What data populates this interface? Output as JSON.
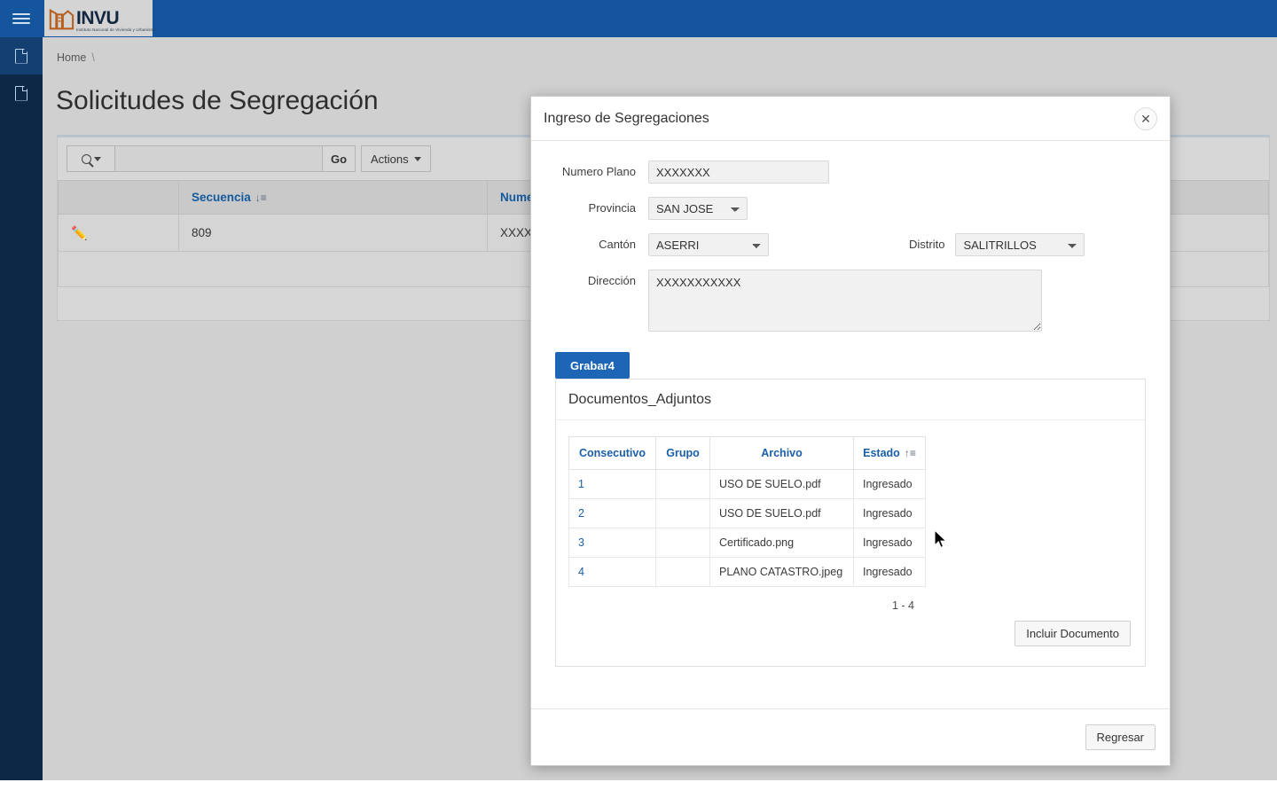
{
  "app": {
    "brand_word": "INVU",
    "brand_tagline": "Instituto Nacional de Vivienda y Urbanismo",
    "menu_icon": "hamburger-icon",
    "header_color": "#14559e",
    "rail_color": "#0d2847"
  },
  "sidebar": {
    "items": [
      {
        "icon": "document-icon",
        "label": ""
      },
      {
        "icon": "document-icon",
        "label": ""
      }
    ]
  },
  "breadcrumb": {
    "home": "Home",
    "separator": "\\"
  },
  "page": {
    "title": "Solicitudes de Segregación"
  },
  "report": {
    "toolbar": {
      "search_icon": "search-icon",
      "search_value": "",
      "search_placeholder": "",
      "go_label": "Go",
      "actions_label": "Actions"
    },
    "columns": [
      {
        "label": "",
        "sort": ""
      },
      {
        "label": "Secuencia",
        "sort": "desc"
      },
      {
        "label": "Nume",
        "sort": ""
      }
    ],
    "rows": [
      {
        "edit_icon": "pencil-icon",
        "secuencia": "809",
        "numero": "XXXX"
      }
    ]
  },
  "modal": {
    "title": "Ingreso de Segregaciones",
    "close_icon": "close-icon",
    "form": {
      "numero_plano": {
        "label": "Numero Plano",
        "value": "XXXXXXX"
      },
      "provincia": {
        "label": "Provincia",
        "value": "SAN JOSE",
        "options": [
          "SAN JOSE"
        ]
      },
      "canton": {
        "label": "Cantón",
        "value": "ASERRI",
        "options": [
          "ASERRI"
        ]
      },
      "distrito": {
        "label": "Distrito",
        "value": "SALITRILLOS",
        "options": [
          "SALITRILLOS"
        ]
      },
      "direccion": {
        "label": "Dirección",
        "value": "XXXXXXXXXXX"
      }
    },
    "grabar_button": {
      "label": "Grabar4",
      "color": "#1c66b5"
    },
    "documents": {
      "title": "Documentos_Adjuntos",
      "columns": [
        {
          "label": "Consecutivo",
          "sort": ""
        },
        {
          "label": "Grupo",
          "sort": ""
        },
        {
          "label": "Archivo",
          "sort": ""
        },
        {
          "label": "Estado",
          "sort": "asc"
        }
      ],
      "rows": [
        {
          "consecutivo": "1",
          "grupo": "",
          "archivo": "USO DE SUELO.pdf",
          "estado": "Ingresado"
        },
        {
          "consecutivo": "2",
          "grupo": "",
          "archivo": "USO DE SUELO.pdf",
          "estado": "Ingresado"
        },
        {
          "consecutivo": "3",
          "grupo": "",
          "archivo": "Certificado.png",
          "estado": "Ingresado"
        },
        {
          "consecutivo": "4",
          "grupo": "",
          "archivo": "PLANO CATASTRO.jpeg",
          "estado": "Ingresado"
        }
      ],
      "pagination": "1 - 4",
      "include_button": "Incluir Documento"
    },
    "footer": {
      "back_button": "Regresar"
    }
  }
}
